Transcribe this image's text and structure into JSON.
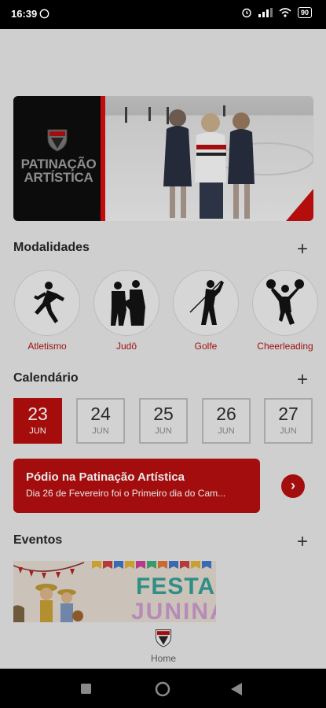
{
  "status": {
    "time": "16:39",
    "battery": "90"
  },
  "banner": {
    "title": "PATINAÇÃO ARTÍSTICA"
  },
  "sections": {
    "modalidades": "Modalidades",
    "calendario": "Calendário",
    "eventos": "Eventos",
    "add_symbol": "+"
  },
  "modalidades": [
    {
      "label": "Atletismo",
      "icon": "runner-icon"
    },
    {
      "label": "Judô",
      "icon": "judo-icon"
    },
    {
      "label": "Golfe",
      "icon": "golfer-icon"
    },
    {
      "label": "Cheerleading",
      "icon": "cheerleader-icon"
    }
  ],
  "calendar": [
    {
      "day": "23",
      "month": "JUN",
      "selected": true
    },
    {
      "day": "24",
      "month": "JUN"
    },
    {
      "day": "25",
      "month": "JUN"
    },
    {
      "day": "26",
      "month": "JUN"
    },
    {
      "day": "27",
      "month": "JUN"
    }
  ],
  "news": {
    "title": "Pódio na Patinação Artística",
    "subtitle": "Dia 26 de Fevereiro foi o Primeiro dia do Cam...",
    "arrow": "›"
  },
  "event": {
    "line1": "FESTA",
    "line2": "JUNINA"
  },
  "nav": {
    "home": "Home"
  },
  "colors": {
    "brand_red": "#a40d0d",
    "background": "#cfcfcf"
  }
}
